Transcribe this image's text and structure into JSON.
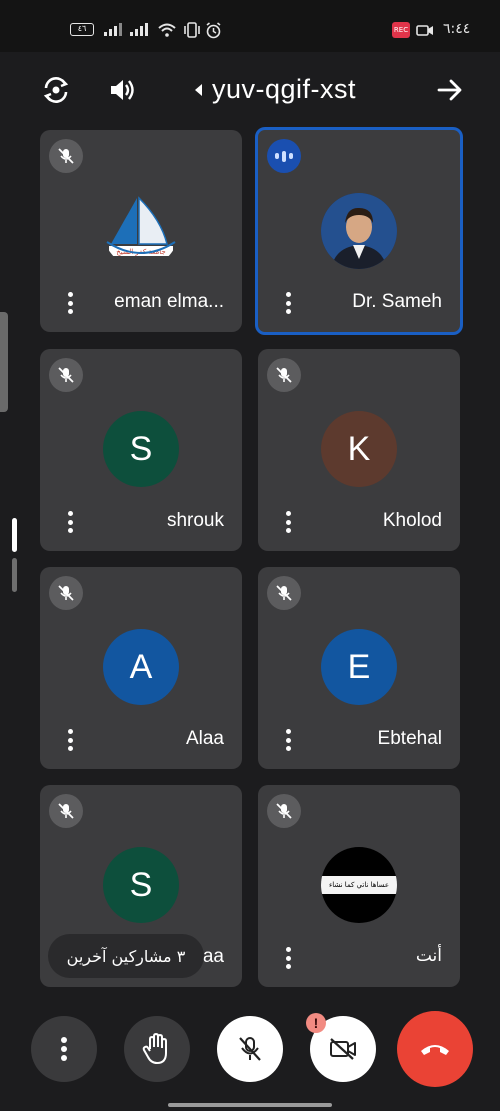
{
  "status_bar": {
    "time": "٦:٤٤",
    "battery": "٤٦"
  },
  "meeting": {
    "code": "yuv-qgif-xst"
  },
  "participants": [
    {
      "name": "eman elma...",
      "initial": "",
      "avatar_color": "#ffffff",
      "muted": true
    },
    {
      "name": "Dr. Sameh",
      "initial": "",
      "avatar_color": "#1b3d7a",
      "muted": false,
      "speaking": true
    },
    {
      "name": "shrouk",
      "initial": "S",
      "avatar_color": "#0d4f3c",
      "muted": true
    },
    {
      "name": "Kholod",
      "initial": "K",
      "avatar_color": "#5d3a2e",
      "muted": true
    },
    {
      "name": "Alaa",
      "initial": "A",
      "avatar_color": "#1256a0",
      "muted": true
    },
    {
      "name": "Ebtehal",
      "initial": "E",
      "avatar_color": "#1256a0",
      "muted": true
    },
    {
      "name": "Asmaa",
      "initial": "S",
      "avatar_color": "#0d4f3c",
      "muted": true
    },
    {
      "name": "أنت",
      "initial": "",
      "avatar_color": "#000000",
      "muted": true
    }
  ],
  "logo_text": "جامعة كفر الشيخ",
  "profile_banner_text": "عساها ناتي كما نشاء",
  "toast": {
    "text": "٣ مشاركين آخرين"
  },
  "controls": {
    "camera_alert_badge": "!"
  },
  "colors": {
    "accent_blue": "#1a5fc4",
    "end_call_red": "#ea4335",
    "tile_bg": "#3c3c3e"
  }
}
